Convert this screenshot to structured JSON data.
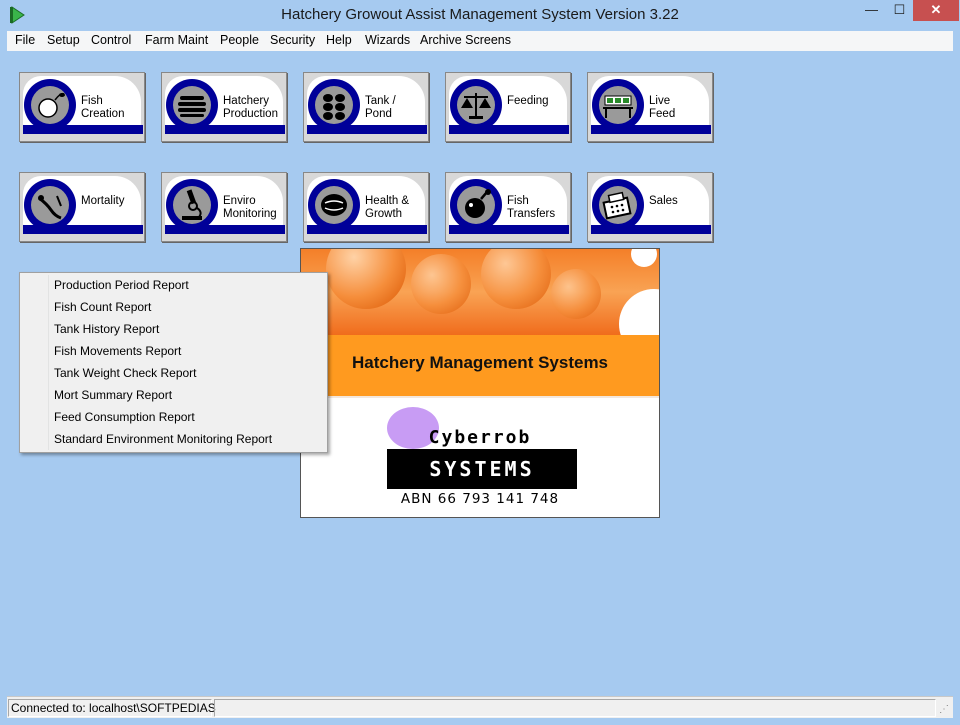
{
  "window": {
    "title": "Hatchery Growout Assist Management System Version 3.22",
    "minimize_glyph": "—",
    "maximize_glyph": "☐",
    "close_glyph": "✕"
  },
  "menu": [
    "File",
    "Setup",
    "Control",
    "Farm Maint",
    "People",
    "Security",
    "Help",
    "Wizards",
    "Archive Screens"
  ],
  "tiles": [
    {
      "label": "Fish\nCreation",
      "icon": "fish-creation-icon"
    },
    {
      "label": "Hatchery\nProduction",
      "icon": "hatchery-production-icon"
    },
    {
      "label": "Tank  /\nPond",
      "icon": "tank-pond-icon"
    },
    {
      "label": "Feeding",
      "icon": "feeding-scales-icon"
    },
    {
      "label": "Live\nFeed",
      "icon": "live-feed-icon"
    },
    {
      "label": "Mortality",
      "icon": "mortality-icon"
    },
    {
      "label": "Enviro\nMonitoring",
      "icon": "microscope-icon"
    },
    {
      "label": "Health &\nGrowth",
      "icon": "health-growth-icon"
    },
    {
      "label": "Fish\nTransfers",
      "icon": "fish-transfers-icon"
    },
    {
      "label": "Sales",
      "icon": "cash-register-icon"
    }
  ],
  "context_menu": [
    "Production Period Report",
    "Fish Count Report",
    "Tank History Report",
    "Fish Movements Report",
    "Tank Weight Check Report",
    "Mort Summary Report",
    "Feed Consumption Report",
    "Standard Environment Monitoring Report"
  ],
  "splash": {
    "title": "Hatchery Management Systems",
    "company": "Cyberrob",
    "systems": "SYSTEMS",
    "abn": "ABN 66 793 141 748"
  },
  "status": {
    "connection": "Connected to: localhost\\SOFTPEDIAS"
  },
  "colors": {
    "desktop": "#a6caf0",
    "tile_accent": "#000099",
    "splash_orange": "#ff9a1f"
  }
}
